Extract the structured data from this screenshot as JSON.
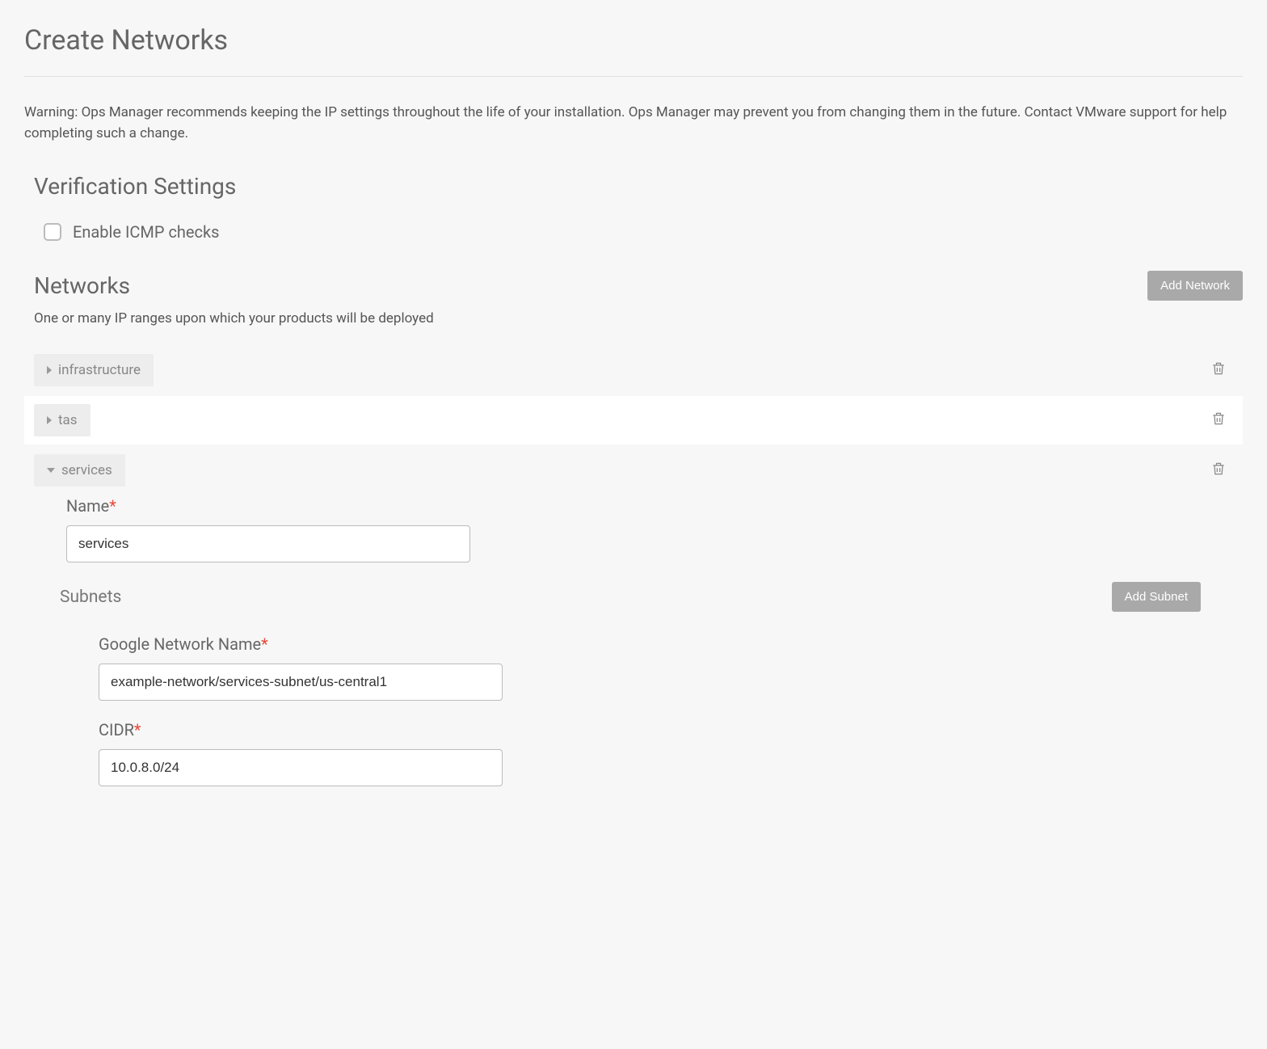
{
  "page_title": "Create Networks",
  "warning_text": "Warning: Ops Manager recommends keeping the IP settings throughout the life of your installation. Ops Manager may prevent you from changing them in the future. Contact VMware support for help completing such a change.",
  "verification": {
    "heading": "Verification Settings",
    "icmp_label": "Enable ICMP checks"
  },
  "networks": {
    "heading": "Networks",
    "add_button": "Add Network",
    "description": "One or many IP ranges upon which your products will be deployed",
    "items": [
      {
        "name": "infrastructure",
        "expanded": false
      },
      {
        "name": "tas",
        "expanded": false
      },
      {
        "name": "services",
        "expanded": true
      }
    ]
  },
  "form": {
    "name_label": "Name",
    "name_value": "services",
    "subnets_heading": "Subnets",
    "add_subnet_button": "Add Subnet",
    "google_network_label": "Google Network Name",
    "google_network_value": "example-network/services-subnet/us-central1",
    "cidr_label": "CIDR",
    "cidr_value": "10.0.8.0/24"
  }
}
